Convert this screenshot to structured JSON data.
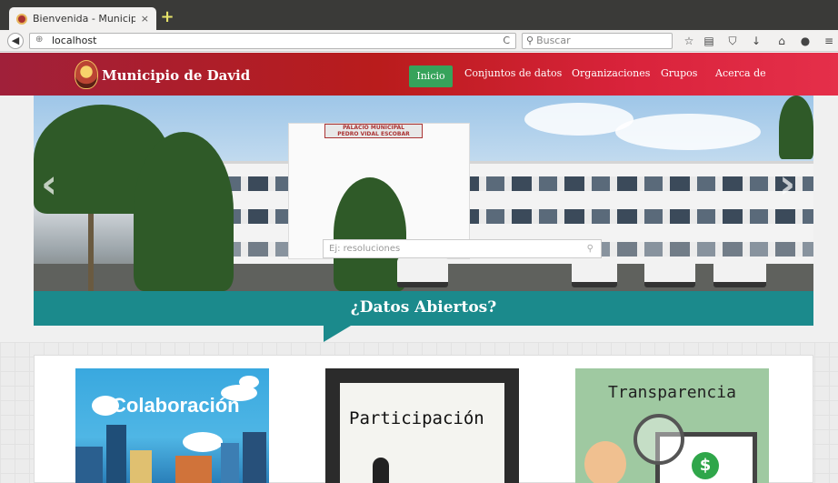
{
  "browser": {
    "tab_title": "Bienvenida - Municip…",
    "tab_close": "×",
    "new_tab": "+",
    "back": "◀",
    "url": "localhost",
    "reload": "C",
    "search_placeholder": "Buscar",
    "search_icon": "⚲",
    "toolbar_icons": [
      "star-icon",
      "reading-list-icon",
      "pocket-icon",
      "download-icon",
      "home-icon",
      "chat-icon",
      "menu-icon"
    ],
    "toolbar_glyphs": [
      "☆",
      "▤",
      "⛉",
      "↓",
      "⌂",
      "●",
      "≡"
    ]
  },
  "site": {
    "brand": "Municipio de David",
    "nav": [
      {
        "label": "Inicio",
        "active": true
      },
      {
        "label": "Conjuntos de datos"
      },
      {
        "label": "Organizaciones"
      },
      {
        "label": "Grupos"
      },
      {
        "label": "Acerca de"
      }
    ],
    "accent": "#36a35b",
    "header_color": "#b91c1c"
  },
  "hero": {
    "sign_line1": "PALACIO MUNICIPAL",
    "sign_line2": "PEDRO VIDAL ESCOBAR",
    "prev_arrow": "‹",
    "next_arrow": "›",
    "search_placeholder": "Ej: resoluciones",
    "search_icon": "⚲",
    "banner_text": "¿Datos Abiertos?",
    "banner_color": "#1b8a8c"
  },
  "cards": [
    {
      "label": "Colaboración"
    },
    {
      "label": "Participación"
    },
    {
      "label": "Transparencia",
      "coin": "$"
    }
  ]
}
